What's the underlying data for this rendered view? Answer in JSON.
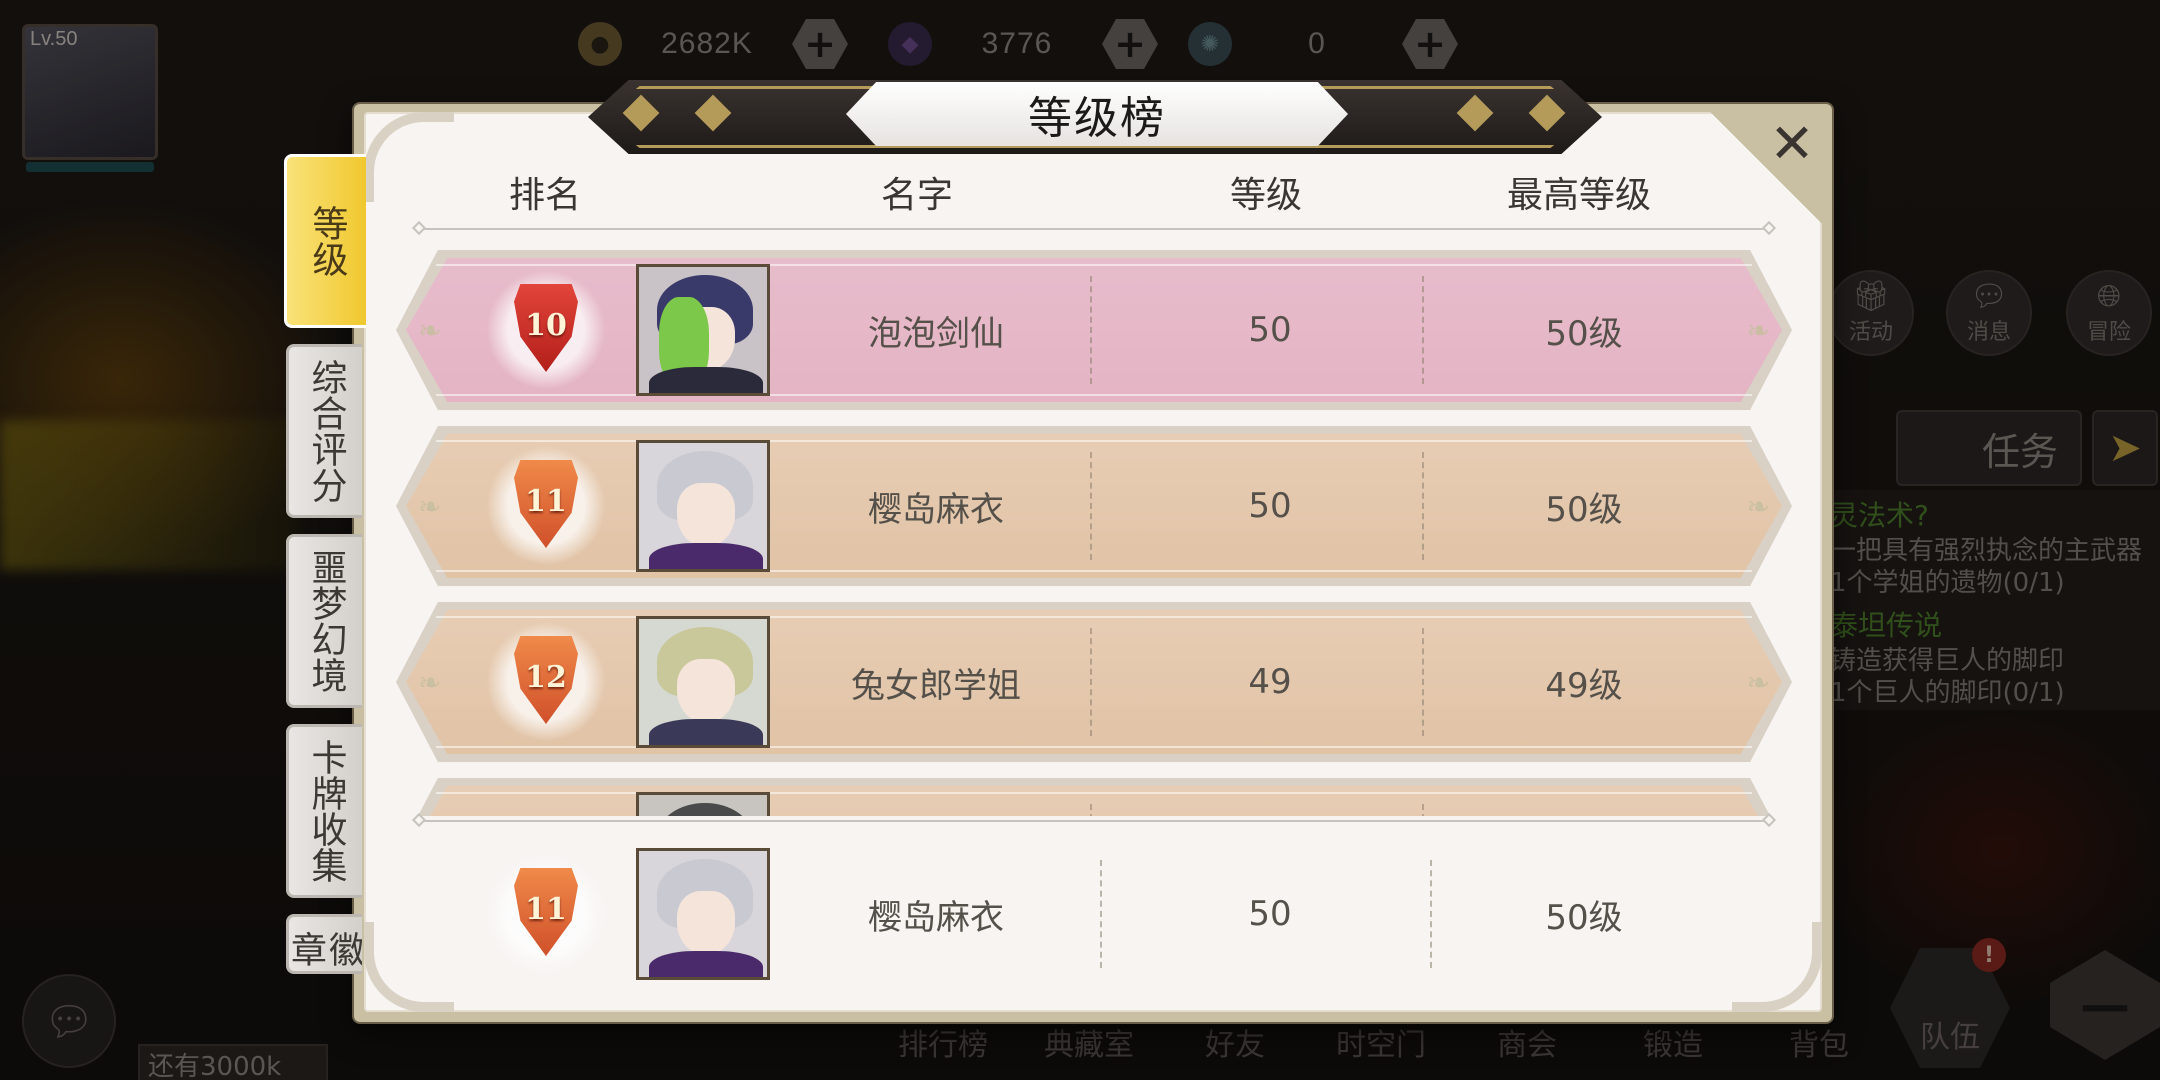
{
  "player": {
    "level": "Lv.50"
  },
  "currency": {
    "gold": "2682K",
    "gems": "3776",
    "tokens": "0",
    "plus": "+"
  },
  "hud": {
    "activity": "活动",
    "message": "消息",
    "adventure": "冒险",
    "task": "任务"
  },
  "quests": [
    {
      "title": "灵法术?",
      "desc1": "一把具有强烈执念的主武器",
      "desc2": "1个学姐的遗物(0/1)"
    },
    {
      "title": "泰坦传说",
      "desc1": "铸造获得巨人的脚印",
      "desc2": "1个巨人的脚印(0/1)"
    }
  ],
  "bottom_nav": [
    "排行榜",
    "典藏室",
    "好友",
    "时空门",
    "商会",
    "锻造",
    "背包"
  ],
  "bottom": {
    "team": "队伍",
    "note": "还有3000k",
    "alert": "!"
  },
  "modal": {
    "title": "等级榜",
    "close": "✕",
    "tabs": [
      "等级",
      "综合评分",
      "噩梦幻境",
      "卡牌收集",
      "徽章"
    ],
    "headers": {
      "rank": "排名",
      "name": "名字",
      "level": "等级",
      "max_level": "最高等级"
    }
  },
  "rows": [
    {
      "rank": "10",
      "name": "泡泡剑仙",
      "level": "50",
      "max_level": "50级"
    },
    {
      "rank": "11",
      "name": "樱岛麻衣",
      "level": "50",
      "max_level": "50级"
    },
    {
      "rank": "12",
      "name": "兔女郎学姐",
      "level": "49",
      "max_level": "49级"
    }
  ],
  "self_row": {
    "rank": "11",
    "name": "樱岛麻衣",
    "level": "50",
    "max_level": "50级"
  },
  "colors": {
    "pink_row": "#e5b8c8",
    "tan_row": "#e3c7ab",
    "active_tab": "#f3cf3e"
  }
}
